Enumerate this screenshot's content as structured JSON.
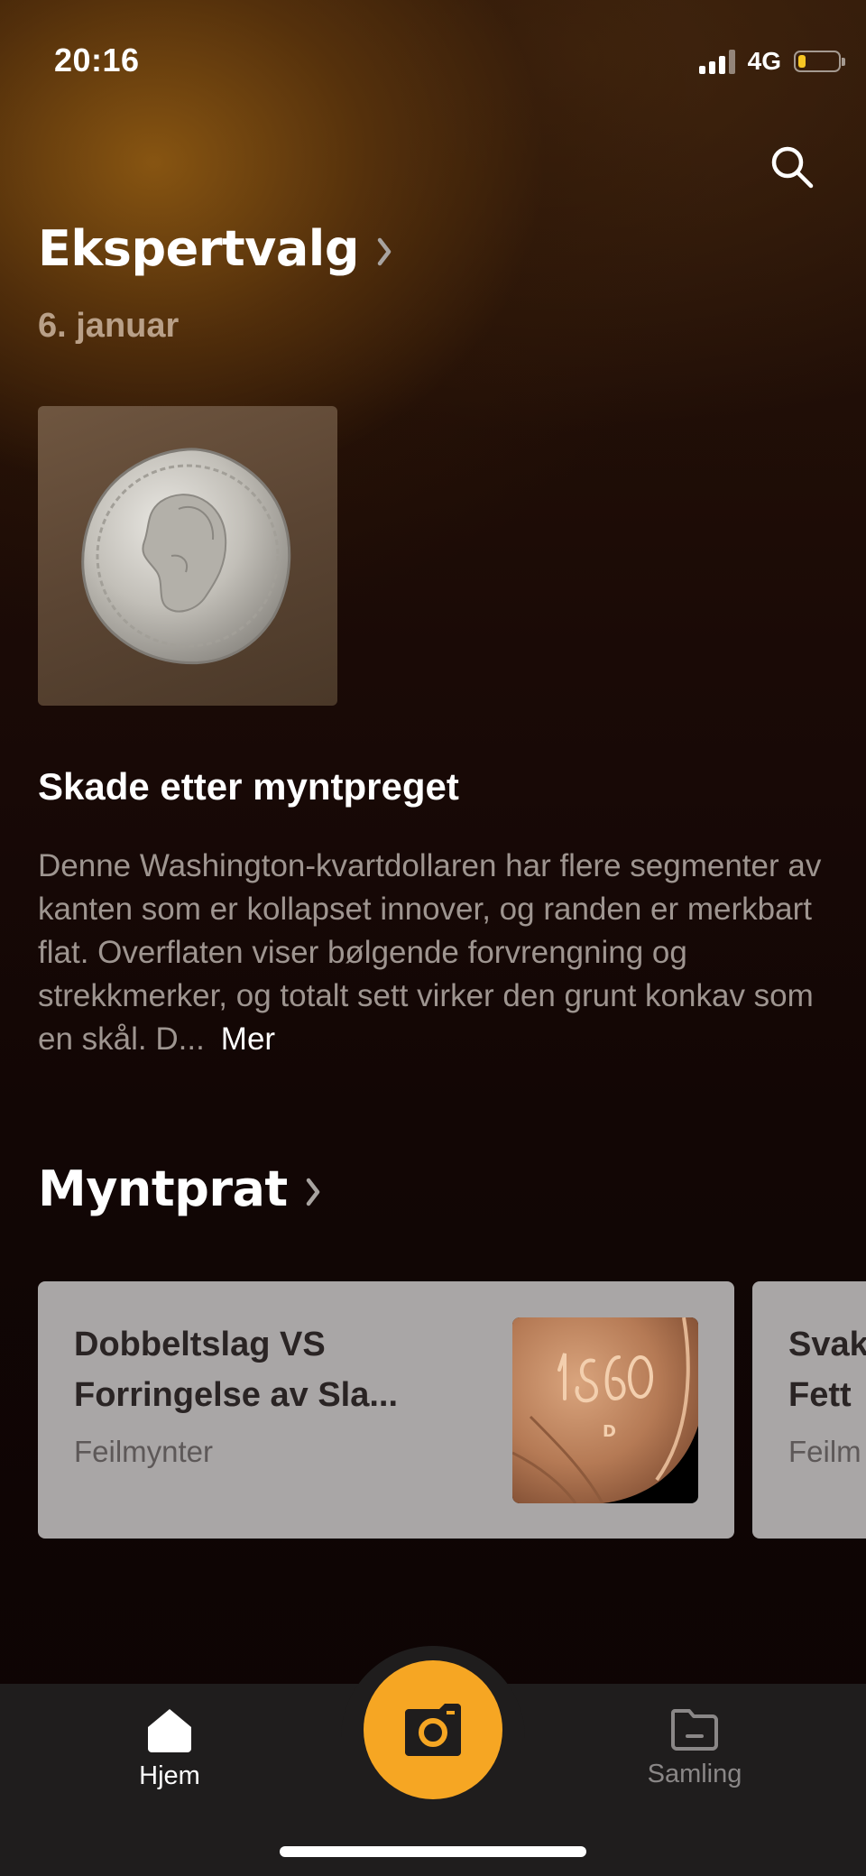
{
  "status_bar": {
    "time": "20:16",
    "network": "4G",
    "battery_level": 0.2,
    "battery_color": "#f7c623"
  },
  "search": {
    "icon": "search-icon"
  },
  "expert_pick": {
    "title": "Ekspertvalg",
    "date": "6. januar",
    "image_icon": "coin-quarter-image",
    "heading": "Skade etter myntpreget",
    "description": "Denne Washington-kvartdollaren har flere segmenter av kanten som er kollapset innover, og randen er merkbart flat. Overflaten viser bølgende forvrengning og strekkmerker, og totalt sett virker den grunt konkav som en skål. D...",
    "more_label": "Mer"
  },
  "myntprat": {
    "title": "Myntprat",
    "cards": [
      {
        "title_line1": "Dobbeltslag VS",
        "title_line2": "Forringelse av Sla...",
        "category": "Feilmynter",
        "thumb_icon": "coin-1960-image"
      },
      {
        "title_line1": "Svak",
        "title_line2": "Fett",
        "category": "Feilm"
      }
    ]
  },
  "tab_bar": {
    "home_label": "Hjem",
    "collection_label": "Samling",
    "camera_icon": "camera-icon",
    "accent_color": "#f6a623"
  }
}
